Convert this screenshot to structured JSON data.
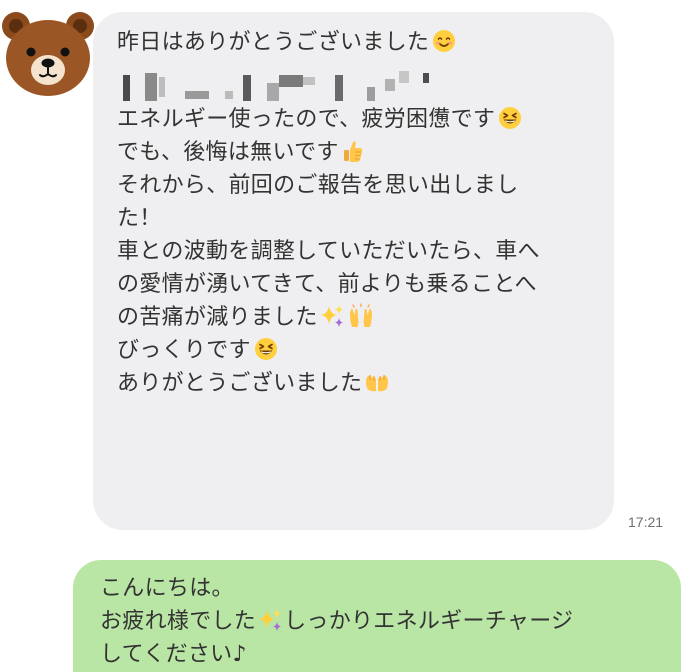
{
  "contact": {
    "avatar_icon": "bear-avatar-icon"
  },
  "incoming_message": {
    "lines": [
      "昨日はありがとうございました",
      "エネルギー使ったので、疲労困憊です",
      "でも、後悔は無いです",
      "それから、前回のご報告を思い出しまし",
      "た！",
      "車との波動を調整していただいたら、車へ",
      "の愛情が湧いてきて、前よりも乗ることへ",
      "の苦痛が減りました",
      "びっくりです",
      "ありがとうございました"
    ],
    "timestamp": "17:21",
    "emoji_icons": [
      "smiling-face-icon",
      "grinning-squinting-face-icon",
      "thumbs-up-icon",
      "sparkles-icon",
      "raising-hands-icon",
      "grinning-squinting-face-icon",
      "palms-up-together-icon"
    ]
  },
  "outgoing_message": {
    "lines": [
      "こんにちは。",
      "お疲れ様でした",
      "しっかりエネルギーチャージ",
      "してください♪"
    ],
    "emoji_icons": [
      "sparkles-icon"
    ]
  },
  "colors": {
    "incoming_bubble": "#efeff1",
    "outgoing_bubble": "#b9e6a5",
    "text": "#333333",
    "timestamp": "#6f6f6f"
  }
}
